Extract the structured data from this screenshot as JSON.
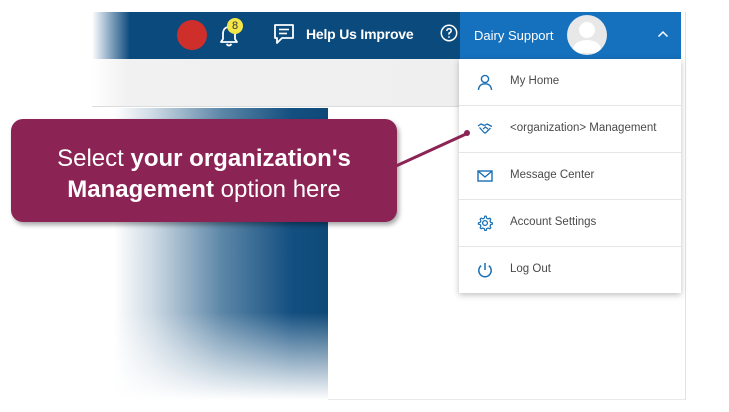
{
  "header": {
    "notification_count": "8",
    "help_improve_label": "Help Us Improve",
    "user_name": "Dairy Support"
  },
  "user_menu": {
    "items": [
      {
        "label": "My Home",
        "icon": "user-icon"
      },
      {
        "label": "<organization> Management",
        "icon": "handshake-icon"
      },
      {
        "label": "Message Center",
        "icon": "envelope-icon"
      },
      {
        "label": "Account Settings",
        "icon": "gear-icon"
      },
      {
        "label": "Log Out",
        "icon": "power-icon"
      }
    ]
  },
  "callout": {
    "line1_plain": "Select ",
    "line1_bold": "your organization's",
    "line2_bold": "Management",
    "line2_plain": " option here"
  },
  "colors": {
    "header_bg": "#0b4a7c",
    "user_trigger_bg": "#1570bd",
    "callout_bg": "#8c2355",
    "icon_blue": "#1a6fb5",
    "status_dot": "#cf2f2a",
    "badge": "#f2e64a"
  }
}
